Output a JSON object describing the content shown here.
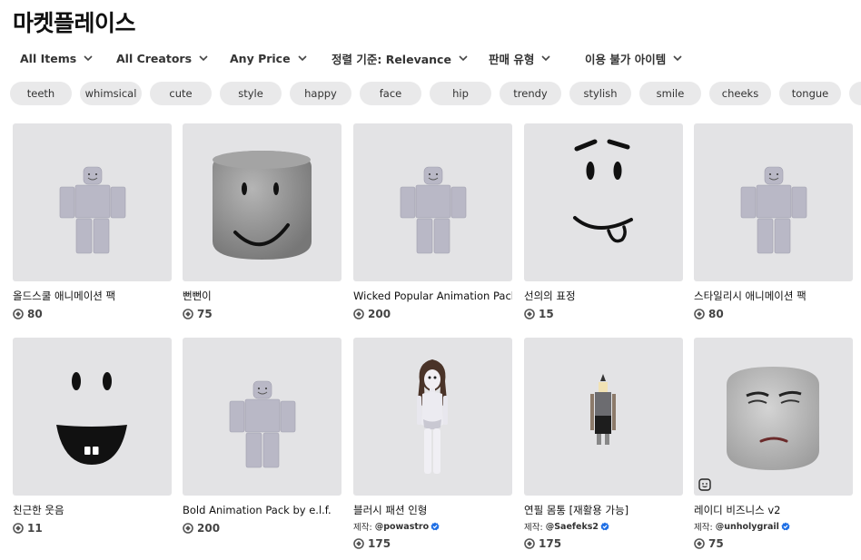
{
  "page": {
    "title": "마켓플레이스"
  },
  "filters": [
    {
      "label": "All Items"
    },
    {
      "label": "All Creators"
    },
    {
      "label": "Any Price"
    },
    {
      "label": "정렬 기준: Relevance"
    },
    {
      "label": "판매 유형"
    },
    {
      "label": "이용 불가 아이템"
    }
  ],
  "tags": [
    "teeth",
    "whimsical",
    "cute",
    "style",
    "happy",
    "face",
    "hip",
    "trendy",
    "stylish",
    "smile",
    "cheeks",
    "tongue",
    ""
  ],
  "items": [
    {
      "name": "올드스쿨 애니메이션 팩",
      "price": "80",
      "creator": "",
      "art": "avatar-pose-icon"
    },
    {
      "name": "뻔뻔이",
      "price": "75",
      "creator": "",
      "art": "smile-head-icon"
    },
    {
      "name": "Wicked Popular Animation Pack",
      "price": "200",
      "creator": "",
      "art": "avatar-pose-icon"
    },
    {
      "name": "선의의 표정",
      "price": "15",
      "creator": "",
      "art": "face-tongue-icon"
    },
    {
      "name": "스타일리시 애니메이션 팩",
      "price": "80",
      "creator": "",
      "art": "avatar-pose-icon"
    },
    {
      "name": "친근한 웃음",
      "price": "11",
      "creator": "",
      "art": "face-grin-icon"
    },
    {
      "name": "Bold Animation Pack by e.l.f.",
      "price": "200",
      "creator": "",
      "art": "avatar-pose-icon"
    },
    {
      "name": "블러시 패션 인형",
      "price": "175",
      "creator": "@powastro",
      "art": "doll-figure-icon"
    },
    {
      "name": "연필 몸통 [재활용 가능]",
      "price": "175",
      "creator": "@Saefeks2",
      "art": "pencil-body-icon"
    },
    {
      "name": "레이디 비즈니스 v2",
      "price": "75",
      "creator": "@unholygrail",
      "art": "stern-head-icon"
    }
  ],
  "labels": {
    "creator_prefix": "제작:"
  },
  "colors": {
    "chip_bg": "#e9e9ea",
    "thumb_bg": "#e3e3e5",
    "verified": "#1e6fe5"
  }
}
